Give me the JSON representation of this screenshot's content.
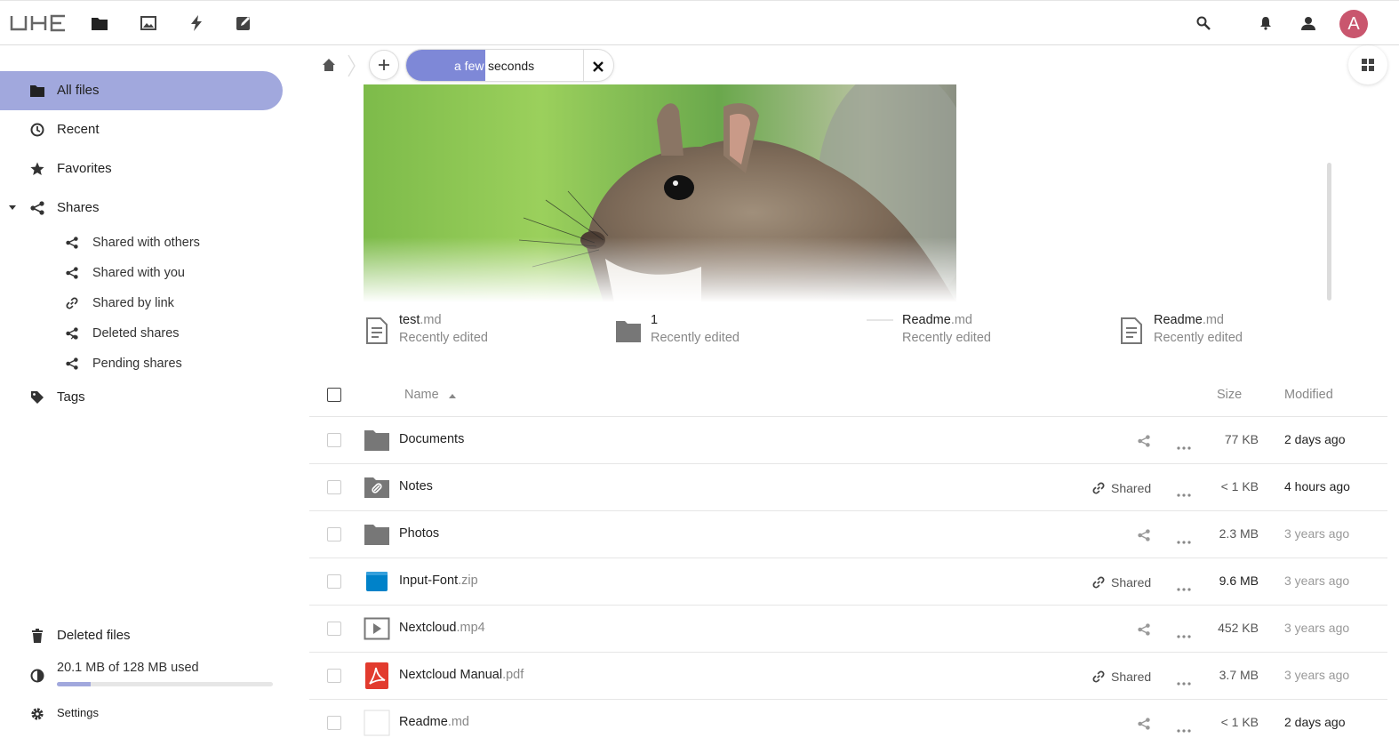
{
  "header": {
    "logo": "UHE",
    "apps": [
      "files-icon",
      "photos-icon",
      "activity-icon",
      "notes-icon"
    ],
    "avatar_letter": "A",
    "colors": {
      "accent": "#a1a8dd",
      "upload": "#7e88d7",
      "avatar": "#c9566e"
    }
  },
  "sidebar": {
    "items": [
      {
        "label": "All files",
        "icon": "folder-icon",
        "active": true
      },
      {
        "label": "Recent",
        "icon": "clock-icon"
      },
      {
        "label": "Favorites",
        "icon": "star-icon"
      },
      {
        "label": "Shares",
        "icon": "share-icon"
      }
    ],
    "shares_sub": [
      {
        "label": "Shared with others",
        "icon": "share-icon"
      },
      {
        "label": "Shared with you",
        "icon": "share-icon"
      },
      {
        "label": "Shared by link",
        "icon": "link-icon"
      },
      {
        "label": "Deleted shares",
        "icon": "deleted-share-icon"
      },
      {
        "label": "Pending shares",
        "icon": "share-icon"
      }
    ],
    "tags": "Tags",
    "deleted_files": "Deleted files",
    "quota": {
      "text": "20.1 MB of 128 MB used",
      "fraction": 0.157
    },
    "settings": "Settings"
  },
  "toolbar": {
    "upload_progress_a": "a few",
    "upload_progress_b": "seconds",
    "upload_fraction": 0.38
  },
  "recent": [
    {
      "name": "test",
      "ext": ".md",
      "sub": "Recently edited",
      "icon": "document-icon"
    },
    {
      "name": "1",
      "ext": "",
      "sub": "Recently edited",
      "icon": "folder-icon"
    },
    {
      "name": "Readme",
      "ext": ".md",
      "sub": "Recently edited",
      "icon": "thumbnail-icon"
    },
    {
      "name": "Readme",
      "ext": ".md",
      "sub": "Recently edited",
      "icon": "document-icon"
    }
  ],
  "table": {
    "headers": {
      "name": "Name",
      "size": "Size",
      "modified": "Modified"
    },
    "rows": [
      {
        "name": "Documents",
        "ext": "",
        "icon": "folder-icon",
        "shared": "",
        "size": "77 KB",
        "modified": "2 days ago"
      },
      {
        "name": "Notes",
        "ext": "",
        "icon": "shared-folder-icon",
        "shared": "Shared",
        "size": "< 1 KB",
        "modified": "4 hours ago"
      },
      {
        "name": "Photos",
        "ext": "",
        "icon": "folder-icon",
        "shared": "",
        "size": "2.3 MB",
        "modified": "3 years ago"
      },
      {
        "name": "Input-Font",
        "ext": ".zip",
        "icon": "zip-icon",
        "shared": "Shared",
        "size": "9.6 MB",
        "modified": "3 years ago"
      },
      {
        "name": "Nextcloud",
        "ext": ".mp4",
        "icon": "video-icon",
        "shared": "",
        "size": "452 KB",
        "modified": "3 years ago"
      },
      {
        "name": "Nextcloud Manual",
        "ext": ".pdf",
        "icon": "pdf-icon",
        "shared": "Shared",
        "size": "3.7 MB",
        "modified": "3 years ago"
      },
      {
        "name": "Readme",
        "ext": ".md",
        "icon": "document-icon",
        "shared": "",
        "size": "< 1 KB",
        "modified": "2 days ago"
      }
    ]
  }
}
